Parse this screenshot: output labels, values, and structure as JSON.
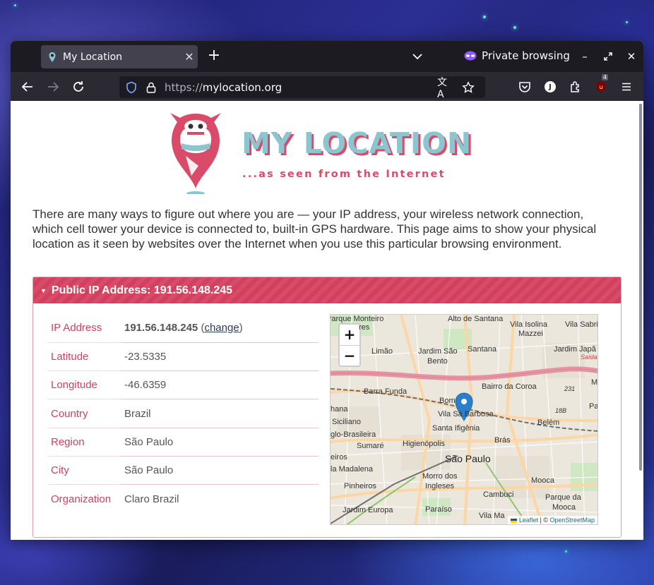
{
  "browser": {
    "tab_title": "My Location",
    "new_tab": "+",
    "private_label": "Private browsing",
    "url_scheme": "https://",
    "url_host": "mylocation.org",
    "extension_badge": "4",
    "account_initial": "J"
  },
  "logo": {
    "title": "MY LOCATION",
    "tagline": "...as seen from the Internet"
  },
  "intro": "There are many ways to figure out where you are — your IP address, your wireless network connection, which cell tower your device is connected to, built-in GPS hardware. This page aims to show your physical location as it seen by websites over the Internet when you use this particular browsing environment.",
  "panel": {
    "title": "Public IP Address: 191.56.148.245",
    "rows": [
      {
        "label": "IP Address",
        "value": "191.56.148.245"
      },
      {
        "label": "Latitude",
        "value": "-23.5335"
      },
      {
        "label": "Longitude",
        "value": "-46.6359"
      },
      {
        "label": "Country",
        "value": "Brazil"
      },
      {
        "label": "Region",
        "value": "São Paulo"
      },
      {
        "label": "City",
        "value": "São Paulo"
      },
      {
        "label": "Organization",
        "value": "Claro Brazil"
      }
    ],
    "change_open": "(",
    "change_link": "change",
    "change_close": ")"
  },
  "map": {
    "zoom_in": "+",
    "zoom_out": "−",
    "attribution_leaflet": "Leaflet",
    "attribution_sep": "| ©",
    "attribution_osm": "OpenStreetMap",
    "labels": {
      "parque_monteiro": "Parque Monteiro",
      "res": "res",
      "alto_de_santana": "Alto de Santana",
      "vila_isolina": "Vila Isolina",
      "mazzei": "Mazzei",
      "vila_sabri": "Vila Sabri",
      "limao": "Limão",
      "jardim_sao_bento": "Jardim São",
      "bento": "Bento",
      "santana": "Santana",
      "jardim_japao": "Jardim Japã",
      "saida": "Saída",
      "barra_funda": "Barra Funda",
      "bairro_da_coroa": "Bairro da Coroa",
      "bom_retiro": "Bom",
      "vila_sa_barbosa": "Vila Sá Barbosa",
      "n231": "231",
      "hana": "hana",
      "siciliano": "Siciliano",
      "n18b": "18B",
      "belem": "Belém",
      "santa_ifigenia": "Santa Ifigênia",
      "glo_brasileira": "glo-Brasileira",
      "sumare": "Sumaré",
      "higienopolis": "Higienópolis",
      "bras": "Brás",
      "eiros": "eiros",
      "sao_paulo": "São Paulo",
      "la_madalena": "la Madalena",
      "morro_dos": "Morro dos",
      "ingleses": "Ingleses",
      "mooca": "Mooca",
      "pinheiros": "Pinheiros",
      "cambuci": "Cambuci",
      "parque_da": "Parque da",
      "mooca2": "Mooca",
      "jardim_europa": "Jardim Europa",
      "paraiso": "Paraíso",
      "vila_mariana": "Vila Ma",
      "pa": "Pa",
      "ma": "M"
    },
    "colors": {
      "marker": "#2a81cb",
      "highway": "#e892a2",
      "major_road": "#fcd6a4",
      "rail": "#707070"
    }
  },
  "colors": {
    "brand": "#d94b69",
    "logo_teal": "#8bc5d0"
  }
}
